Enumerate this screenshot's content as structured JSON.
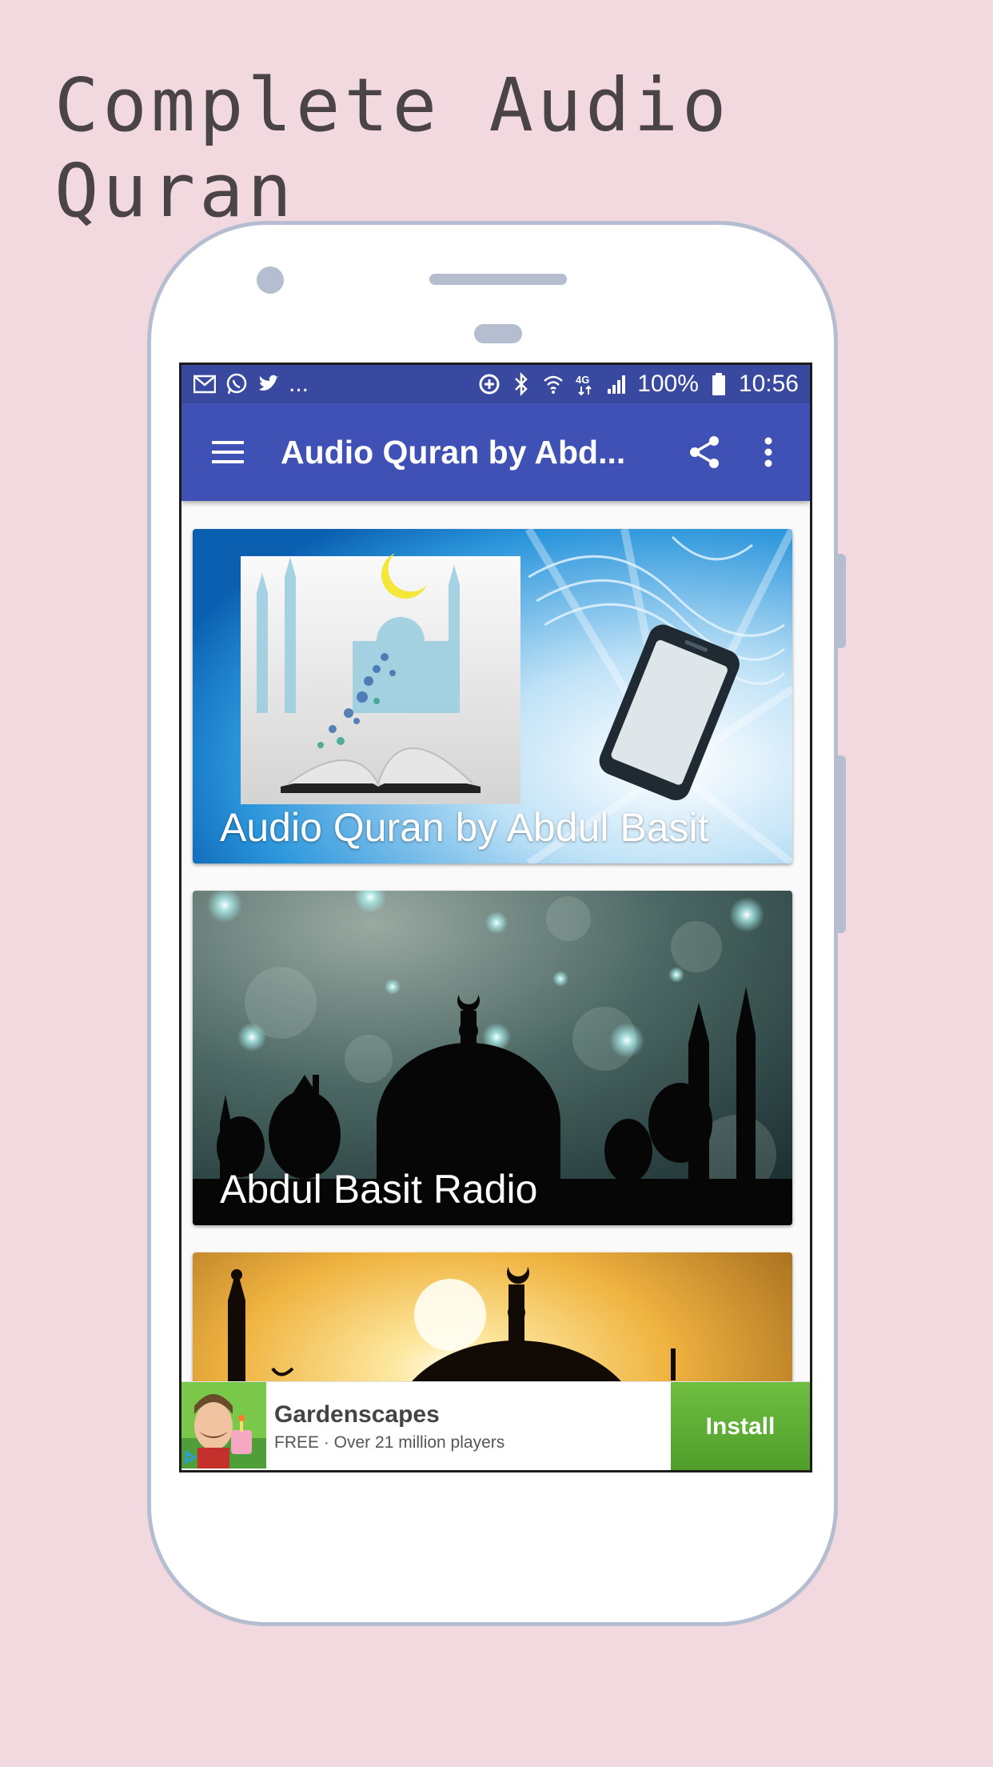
{
  "headline": "Complete Audio Quran",
  "status_bar": {
    "left_icons": [
      "gmail-icon",
      "whatsapp-icon",
      "twitter-icon"
    ],
    "overflow": "...",
    "right_icons": [
      "data-saver-icon",
      "bluetooth-icon",
      "wifi-icon",
      "4g-icon",
      "signal-icon"
    ],
    "battery": "100%",
    "time": "10:56"
  },
  "toolbar": {
    "title": "Audio Quran by Abd...",
    "menu_icon": "hamburger-menu-icon",
    "share_icon": "share-icon",
    "more_icon": "more-vert-icon"
  },
  "cards": [
    {
      "title": "Audio Quran by Abdul Basit"
    },
    {
      "title": "Abdul Basit Radio"
    },
    {
      "title": ""
    }
  ],
  "ad": {
    "name": "Gardenscapes",
    "subtitle": "FREE · Over 21 million players",
    "install_label": "Install"
  },
  "colors": {
    "background": "#f2d9df",
    "status_bar": "#3949a0",
    "toolbar": "#3f51b5",
    "install": "#5faf36"
  }
}
